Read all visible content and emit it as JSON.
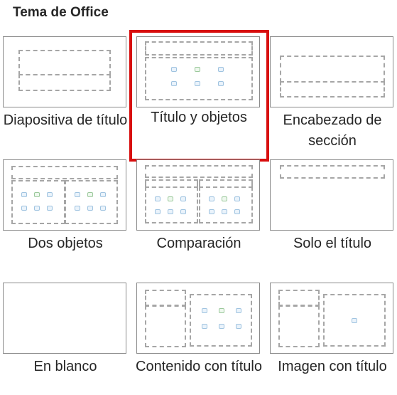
{
  "header": {
    "title": "Tema de Office"
  },
  "selected_layout": "Título y objetos",
  "layouts": [
    {
      "label": "Diapositiva de título"
    },
    {
      "label": "Título y objetos"
    },
    {
      "label": "Encabezado de sección"
    },
    {
      "label": "Dos objetos"
    },
    {
      "label": "Comparación"
    },
    {
      "label": "Solo el título"
    },
    {
      "label": "En blanco"
    },
    {
      "label": "Contenido con título"
    },
    {
      "label": "Imagen con título"
    }
  ],
  "colors": {
    "selection": "#d80e0e",
    "placeholder_border": "#a6a6a6"
  },
  "icons": [
    "table-icon",
    "chart-icon",
    "smartart-icon",
    "picture-icon",
    "online-picture-icon",
    "video-icon"
  ]
}
